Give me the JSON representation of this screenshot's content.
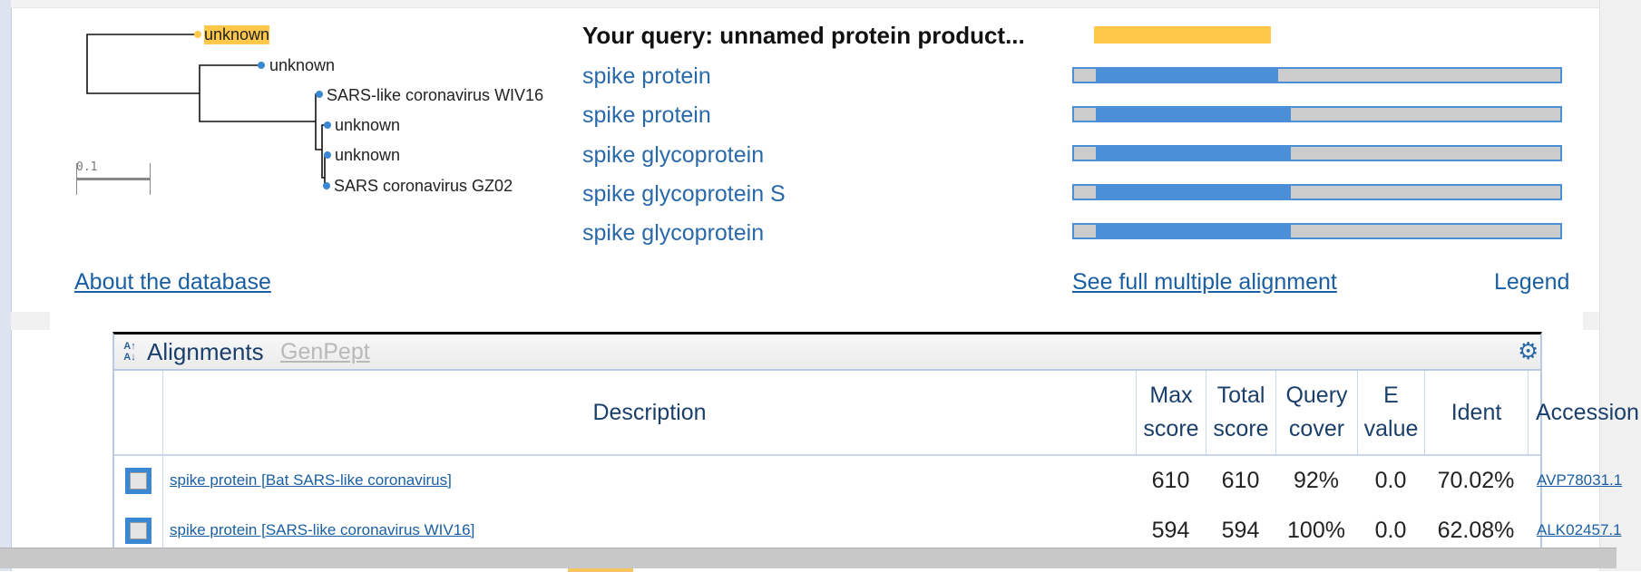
{
  "tree": {
    "leaves": [
      {
        "label": "unknown",
        "highlight": true
      },
      {
        "label": "unknown",
        "highlight": false
      },
      {
        "label": "SARS-like coronavirus WIV16",
        "highlight": false
      },
      {
        "label": "unknown",
        "highlight": false
      },
      {
        "label": "unknown",
        "highlight": false
      },
      {
        "label": "SARS coronavirus GZ02",
        "highlight": false
      }
    ],
    "scale_label": "0.1"
  },
  "query": {
    "title": "Your query: unnamed protein product...",
    "bar_color": "#ffc84a"
  },
  "hits": [
    {
      "name": "spike protein",
      "aligned_fraction": 0.375
    },
    {
      "name": "spike protein",
      "aligned_fraction": 0.4
    },
    {
      "name": "spike glycoprotein",
      "aligned_fraction": 0.4
    },
    {
      "name": "spike glycoprotein S",
      "aligned_fraction": 0.4
    },
    {
      "name": "spike glycoprotein",
      "aligned_fraction": 0.4
    }
  ],
  "links": {
    "about": "About the database",
    "full_alignment": "See full multiple alignment",
    "legend": "Legend"
  },
  "alignments": {
    "title": "Alignments",
    "tab": "GenPept",
    "sort_icon": "sort-az-icon",
    "settings_icon": "gear-icon",
    "columns": [
      {
        "key": "select",
        "label": ""
      },
      {
        "key": "description",
        "label": "Description"
      },
      {
        "key": "max_score",
        "label": "Max score"
      },
      {
        "key": "total_score",
        "label": "Total score"
      },
      {
        "key": "query_cover",
        "label": "Query cover"
      },
      {
        "key": "e_value",
        "label": "E value"
      },
      {
        "key": "ident",
        "label": "Ident"
      },
      {
        "key": "accession",
        "label": "Accession"
      }
    ],
    "rows": [
      {
        "description": "spike protein [Bat SARS-like coronavirus]",
        "max_score": "610",
        "total_score": "610",
        "query_cover": "92%",
        "e_value": "0.0",
        "ident": "70.02%",
        "accession": "AVP78031.1"
      },
      {
        "description": "spike protein [SARS-like coronavirus WIV16]",
        "max_score": "594",
        "total_score": "594",
        "query_cover": "100%",
        "e_value": "0.0",
        "ident": "62.08%",
        "accession": "ALK02457.1"
      }
    ]
  },
  "colors": {
    "link": "#1a5fa3",
    "bar_fill": "#4a8fd8",
    "bar_track": "#cccccc",
    "highlight": "#ffc84a"
  }
}
